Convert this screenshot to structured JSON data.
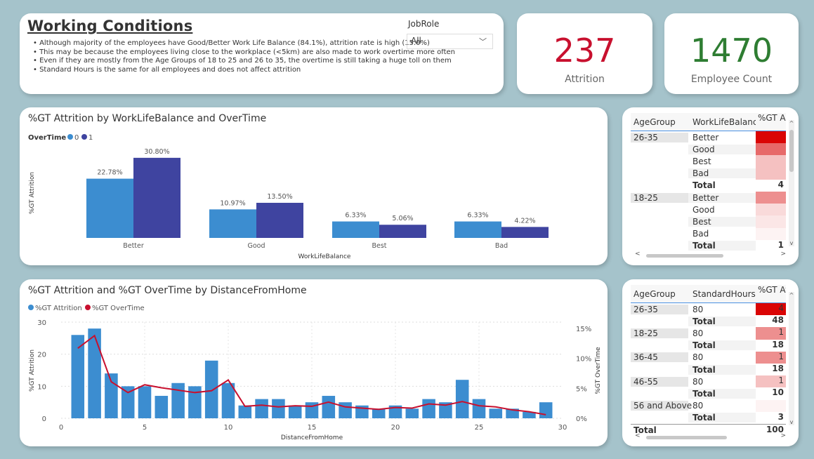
{
  "header": {
    "title": "Working Conditions",
    "bullets": [
      "• Although majority of the employees have Good/Better Work Life Balance (84.1%), attrition rate is high (15.0%)",
      "• This may be because the employees living close to the workplace (<5km) are also made to work overtime more often",
      "• Even if they are mostly from the Age Groups of 18 to 25 and 26 to 35, the overtime is still taking a huge toll on them",
      "• Standard Hours is the same for all employees and does not affect attrition"
    ],
    "jobrole_label": "JobRole",
    "jobrole_value": "All"
  },
  "kpis": {
    "attrition_value": "237",
    "attrition_label": "Attrition",
    "attrition_color": "#c8102e",
    "employee_value": "1470",
    "employee_label": "Employee Count",
    "employee_color": "#2e7d32"
  },
  "colors": {
    "series0": "#3c8dd0",
    "series1": "#3f44a0",
    "overtime_line": "#c8102e",
    "attrition_bar": "#3c8dd0"
  },
  "chart_data": [
    {
      "type": "bar",
      "title": "%GT Attrition by WorkLifeBalance and OverTime",
      "legend_title": "OverTime",
      "xlabel": "WorkLifeBalance",
      "ylabel": "%GT Attrition",
      "categories": [
        "Better",
        "Good",
        "Best",
        "Bad"
      ],
      "series": [
        {
          "name": "0",
          "values": [
            22.78,
            10.97,
            6.33,
            6.33
          ],
          "labels": [
            "22.78%",
            "10.97%",
            "6.33%",
            "6.33%"
          ]
        },
        {
          "name": "1",
          "values": [
            30.8,
            13.5,
            5.06,
            4.22
          ],
          "labels": [
            "30.80%",
            "13.50%",
            "5.06%",
            "4.22%"
          ]
        }
      ],
      "ylim": [
        0,
        34
      ],
      "legend_position": "top-left"
    },
    {
      "type": "bar",
      "title": "%GT Attrition and %GT OverTime by DistanceFromHome",
      "xlabel": "DistanceFromHome",
      "ylabel": "%GT Attrition",
      "y2label": "%GT OverTime",
      "series": [
        {
          "name": "%GT Attrition",
          "type": "bar",
          "x": [
            1,
            2,
            3,
            4,
            5,
            6,
            7,
            8,
            9,
            10,
            11,
            12,
            13,
            14,
            15,
            16,
            17,
            18,
            19,
            20,
            21,
            22,
            23,
            24,
            25,
            26,
            27,
            28,
            29
          ],
          "values": [
            26,
            28,
            14,
            10,
            10,
            7,
            11,
            10,
            18,
            11,
            4,
            6,
            6,
            4,
            5,
            7,
            5,
            4,
            3,
            4,
            3,
            6,
            5,
            12,
            6,
            3,
            3,
            2,
            5
          ]
        },
        {
          "name": "%GT OverTime",
          "type": "line",
          "x": [
            1,
            2,
            3,
            4,
            5,
            6,
            7,
            8,
            9,
            10,
            11,
            12,
            13,
            14,
            15,
            16,
            17,
            18,
            19,
            20,
            21,
            22,
            23,
            24,
            25,
            26,
            27,
            28,
            29
          ],
          "values": [
            11.7,
            13.8,
            6.1,
            4.3,
            5.6,
            5.1,
            4.7,
            4.3,
            4.6,
            6.4,
            2.0,
            2.2,
            1.9,
            2.1,
            2.0,
            2.7,
            1.9,
            1.7,
            1.5,
            1.8,
            1.7,
            2.4,
            2.2,
            2.8,
            2.1,
            1.9,
            1.4,
            1.1,
            0.6
          ]
        }
      ],
      "xlim": [
        0,
        30
      ],
      "ylim": [
        0,
        30
      ],
      "y2lim": [
        0,
        15
      ],
      "xticks": [
        "0",
        "5",
        "10",
        "15",
        "20",
        "25",
        "30"
      ],
      "yticks": [
        "0",
        "10",
        "20",
        "30"
      ],
      "y2ticks": [
        "0%",
        "5%",
        "10%",
        "15%"
      ],
      "legend_position": "top-left"
    }
  ],
  "table1": {
    "headers": [
      "AgeGroup",
      "WorkLifeBalance",
      "%GT A"
    ],
    "rows": [
      {
        "group": "26-35",
        "wlb": "Better",
        "value": "",
        "shade": 1.0
      },
      {
        "group": "",
        "wlb": "Good",
        "value": "",
        "shade": 0.6
      },
      {
        "group": "",
        "wlb": "Best",
        "value": "",
        "shade": 0.25
      },
      {
        "group": "",
        "wlb": "Bad",
        "value": "",
        "shade": 0.25
      },
      {
        "group": "",
        "wlb": "Total",
        "value": "4",
        "shade": 0,
        "total": true
      },
      {
        "group": "18-25",
        "wlb": "Better",
        "value": "",
        "shade": 0.45
      },
      {
        "group": "",
        "wlb": "Good",
        "value": "",
        "shade": 0.15
      },
      {
        "group": "",
        "wlb": "Best",
        "value": "",
        "shade": 0.1
      },
      {
        "group": "",
        "wlb": "Bad",
        "value": "",
        "shade": 0.05
      },
      {
        "group": "",
        "wlb": "Total",
        "value": "1",
        "shade": 0,
        "total": true
      }
    ]
  },
  "table2": {
    "headers": [
      "AgeGroup",
      "StandardHours",
      "%GT Att"
    ],
    "rows": [
      {
        "group": "26-35",
        "hours": "80",
        "value": "4",
        "shade": 1.0
      },
      {
        "group": "",
        "hours": "Total",
        "value": "48",
        "shade": 0,
        "total": true
      },
      {
        "group": "18-25",
        "hours": "80",
        "value": "1",
        "shade": 0.45
      },
      {
        "group": "",
        "hours": "Total",
        "value": "18",
        "shade": 0,
        "total": true
      },
      {
        "group": "36-45",
        "hours": "80",
        "value": "1",
        "shade": 0.45
      },
      {
        "group": "",
        "hours": "Total",
        "value": "18",
        "shade": 0,
        "total": true
      },
      {
        "group": "46-55",
        "hours": "80",
        "value": "1",
        "shade": 0.25
      },
      {
        "group": "",
        "hours": "Total",
        "value": "10",
        "shade": 0,
        "total": true
      },
      {
        "group": "56 and Above",
        "hours": "80",
        "value": "",
        "shade": 0.05
      },
      {
        "group": "",
        "hours": "Total",
        "value": "3",
        "shade": 0,
        "total": true
      }
    ],
    "grand_total_label": "Total",
    "grand_total_value": "100"
  }
}
